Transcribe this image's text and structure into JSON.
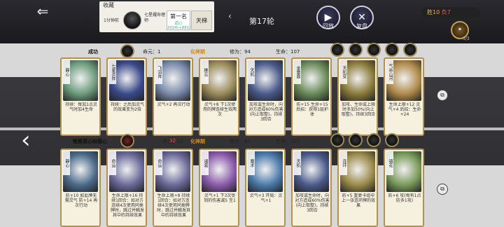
{
  "header": {
    "back_icon": "back-arrow-icon",
    "record_title": "收藏",
    "record_left": "1分钟前",
    "record_name": "七星耀命理师",
    "rank_label": "第一名",
    "rank_score": "道心 3024(+881)",
    "ladder_label": "天梯",
    "round_label": "第17轮",
    "replay_label": "回放",
    "review_label": "复盘",
    "score_win": "胜10",
    "score_lose": "负7",
    "turn_count": "3/3"
  },
  "player_top": {
    "status": "成功",
    "mingyuan_label": "命元：1",
    "realm": "化神期",
    "xiuwei": "修为：94",
    "health": "生命：107",
    "cards": [
      {
        "name": "静心",
        "cost": "",
        "text": "持续：每加1点灵气时加4生命",
        "art": "#6c9a7c"
      },
      {
        "name": "七星灵阵",
        "cost": "",
        "text": "持续：之后加灵气的效果变为2倍",
        "art": "#3a4a8a"
      },
      {
        "name": "飞羽阵",
        "cost": "",
        "text": "灵气+2 再次行动",
        "art": "#7a8aaa"
      },
      {
        "name": "拂云",
        "cost": "1",
        "text": "灵气+8 下1次使用的牌连续生效两次",
        "art": "#9a8a5a"
      },
      {
        "name": "天机",
        "cost": "",
        "text": "加攻或生命时，向对方造成60%伤害(向上取整)，持续3回合",
        "art": "#4a5a8a"
      },
      {
        "name": "金雷震",
        "cost": "",
        "text": "防+15 生命+15 后招：获得1层护体",
        "art": "#6a8a5a"
      },
      {
        "name": "天机变",
        "cost": "",
        "text": "加攻、生命或上限时多加50%(向上取整)，持续3回合",
        "art": "#8a7a3a"
      },
      {
        "name": "气吞山河",
        "cost": "",
        "text": "生命上限+12 灵气+4 后招：生命+24",
        "art": "#b08a4a"
      }
    ]
  },
  "player_bottom": {
    "status": "惟愿君心似我心",
    "mingyuan_label": "命元：24",
    "mingyuan_extra": "32",
    "realm": "化神期",
    "xiuwei": "修为：83",
    "health": "生命：107",
    "cards": [
      {
        "name": "静心",
        "cost": "",
        "text": "防+10 如此牌无需灵气 防+14 再次行动",
        "art": "#4a6a8a"
      },
      {
        "name": "命运",
        "cost": "",
        "text": "生命上限+16 持续1回合：如对方连续4次使用同类牌时，跳过并触发其中的持续效果",
        "art": "#6a6a9a"
      },
      {
        "name": "命运",
        "cost": "",
        "text": "生命上限+8 持续1回合：如对方连续4次使用同类牌时，跳过并触发其中的持续效果",
        "art": "#6a6a9a"
      },
      {
        "name": "诸葛",
        "cost": "",
        "text": "灵气+1 下3次受到的伤害减5 至1",
        "art": "#8a5aaa"
      },
      {
        "name": "魔术",
        "cost": "",
        "text": "灵气+3 开局：灵气+1",
        "art": "#4a7aaa"
      },
      {
        "name": "天机",
        "cost": "",
        "text": "加攻或生命时，向对方造成60%伤害(向上取整)，持续3回合",
        "art": "#4a5a8a"
      },
      {
        "name": "连环",
        "cost": "",
        "text": "防+5 重复卡组中上一张连环牌的效果",
        "art": "#9a8a4a"
      },
      {
        "name": "镇花",
        "cost": "",
        "text": "防+6 攻(每有1点防多1攻)",
        "art": "#7a9a5a"
      }
    ]
  }
}
